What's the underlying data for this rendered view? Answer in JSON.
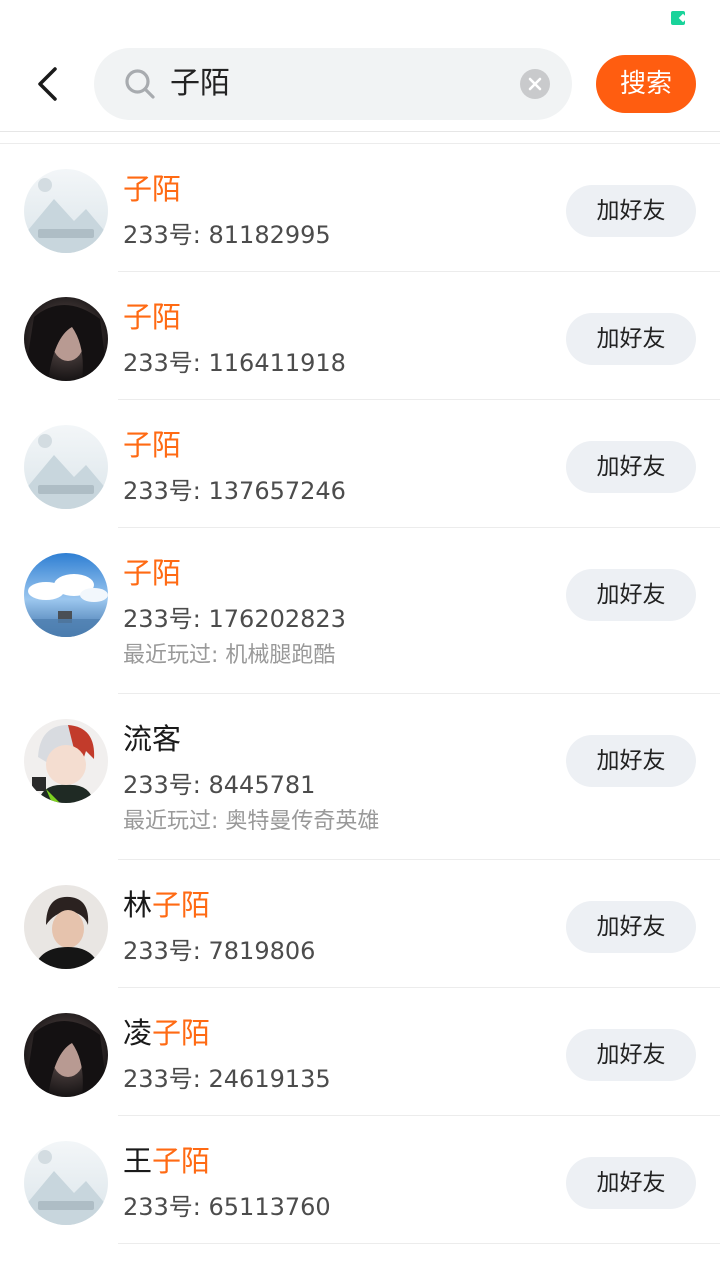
{
  "header": {
    "search_query": "子陌",
    "search_button_label": "搜索"
  },
  "results": [
    {
      "name_prefix": "",
      "name_match": "子陌",
      "id_text": "233号: 81182995",
      "recent": "",
      "add_label": "加好友",
      "avatar": "placeholder-image"
    },
    {
      "name_prefix": "",
      "name_match": "子陌",
      "id_text": "233号: 116411918",
      "recent": "",
      "add_label": "加好友",
      "avatar": "dark-photo"
    },
    {
      "name_prefix": "",
      "name_match": "子陌",
      "id_text": "233号: 137657246",
      "recent": "",
      "add_label": "加好友",
      "avatar": "placeholder-image"
    },
    {
      "name_prefix": "",
      "name_match": "子陌",
      "id_text": "233号: 176202823",
      "recent": "最近玩过: 机械腿跑酷",
      "add_label": "加好友",
      "avatar": "sky-photo"
    },
    {
      "name_prefix": "流客",
      "name_match": "",
      "id_text": "233号: 8445781",
      "recent": "最近玩过: 奥特曼传奇英雄",
      "add_label": "加好友",
      "avatar": "anime-character"
    },
    {
      "name_prefix": "林",
      "name_match": "子陌",
      "id_text": "233号: 7819806",
      "recent": "",
      "add_label": "加好友",
      "avatar": "portrait-photo"
    },
    {
      "name_prefix": "凌",
      "name_match": "子陌",
      "id_text": "233号: 24619135",
      "recent": "",
      "add_label": "加好友",
      "avatar": "dark-photo"
    },
    {
      "name_prefix": "王",
      "name_match": "子陌",
      "id_text": "233号: 65113760",
      "recent": "",
      "add_label": "加好友",
      "avatar": "placeholder-image"
    }
  ],
  "colors": {
    "accent": "#ff6a13",
    "search_button": "#ff5d10",
    "add_button_bg": "#edf0f4"
  }
}
